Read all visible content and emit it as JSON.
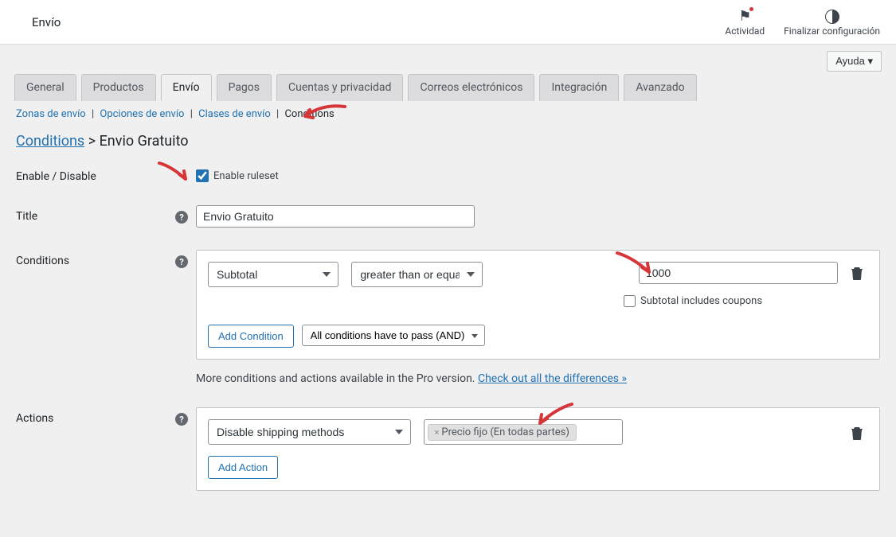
{
  "header": {
    "title": "Envío",
    "activity_label": "Actividad",
    "finish_label": "Finalizar configuración"
  },
  "help_button": "Ayuda ▾",
  "tabs": [
    {
      "label": "General",
      "active": false
    },
    {
      "label": "Productos",
      "active": false
    },
    {
      "label": "Envío",
      "active": true
    },
    {
      "label": "Pagos",
      "active": false
    },
    {
      "label": "Cuentas y privacidad",
      "active": false
    },
    {
      "label": "Correos electrónicos",
      "active": false
    },
    {
      "label": "Integración",
      "active": false
    },
    {
      "label": "Avanzado",
      "active": false
    }
  ],
  "sublinks": {
    "zones": "Zonas de envío",
    "options": "Opciones de envío",
    "classes": "Clases de envío",
    "conditions": "Conditions"
  },
  "breadcrumb": {
    "parent": "Conditions",
    "current": "Envio Gratuito"
  },
  "form": {
    "enable": {
      "label": "Enable / Disable",
      "checkbox_label": "Enable ruleset",
      "checked": true
    },
    "title": {
      "label": "Title",
      "value": "Envio Gratuito"
    },
    "conditions": {
      "label": "Conditions",
      "rule": {
        "field": "Subtotal",
        "operator": "greater than or equal",
        "value": "1000",
        "coupons_label": "Subtotal includes coupons",
        "coupons_checked": false
      },
      "add_button": "Add Condition",
      "logic": "All conditions have to pass (AND)",
      "pro_text": "More conditions and actions available in the Pro version. ",
      "pro_link": "Check out all the differences »"
    },
    "actions": {
      "label": "Actions",
      "action_type": "Disable shipping methods",
      "tag": "Precio fijo (En todas partes)",
      "add_button": "Add Action"
    }
  }
}
